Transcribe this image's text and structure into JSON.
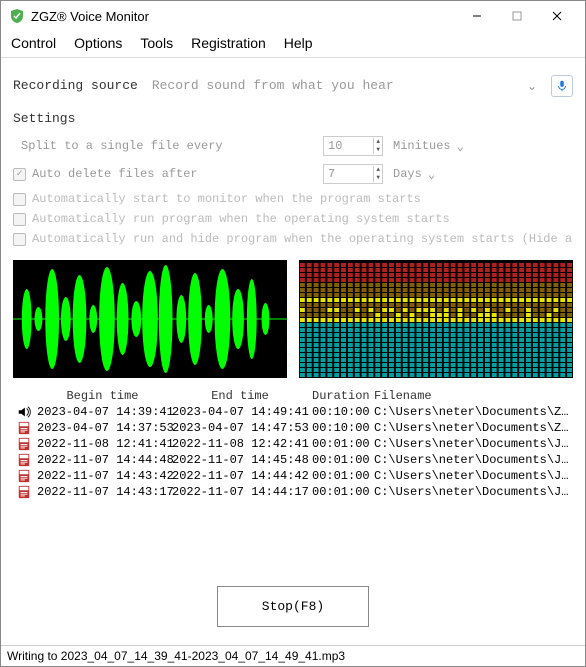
{
  "window": {
    "title": "ZGZ® Voice Monitor"
  },
  "menu": {
    "items": [
      {
        "label": "Control"
      },
      {
        "label": "Options"
      },
      {
        "label": "Tools"
      },
      {
        "label": "Registration"
      },
      {
        "label": "Help"
      }
    ]
  },
  "source": {
    "label": "Recording source",
    "value": "Record sound from what you hear"
  },
  "settings": {
    "header": "Settings",
    "split": {
      "label": "Split to a single file every",
      "value": "10",
      "unit": "Minitues"
    },
    "autodelete": {
      "label": "Auto delete files after",
      "value": "7",
      "unit": "Days",
      "checked": true
    },
    "opts": [
      {
        "label": "Automatically start to monitor when the program starts",
        "checked": false
      },
      {
        "label": "Automatically run program when the operating system starts",
        "checked": false
      },
      {
        "label": "Automatically run and hide program when the operating system starts (Hide and show hotk",
        "checked": false
      }
    ]
  },
  "table": {
    "headers": {
      "begin": "Begin time",
      "end": "End time",
      "dur": "Duration",
      "file": "Filename"
    },
    "rows": [
      {
        "playing": true,
        "begin": "2023-04-07 14:39:41",
        "end": "2023-04-07 14:49:41",
        "dur": "00:10:00",
        "file": "C:\\Users\\neter\\Documents\\ZGZ ..."
      },
      {
        "playing": false,
        "begin": "2023-04-07 14:37:53",
        "end": "2023-04-07 14:47:53",
        "dur": "00:10:00",
        "file": "C:\\Users\\neter\\Documents\\ZGZ ..."
      },
      {
        "playing": false,
        "begin": "2022-11-08 12:41:41",
        "end": "2022-11-08 12:42:41",
        "dur": "00:01:00",
        "file": "C:\\Users\\neter\\Documents\\JFY ..."
      },
      {
        "playing": false,
        "begin": "2022-11-07 14:44:48",
        "end": "2022-11-07 14:45:48",
        "dur": "00:01:00",
        "file": "C:\\Users\\neter\\Documents\\JFY ..."
      },
      {
        "playing": false,
        "begin": "2022-11-07 14:43:42",
        "end": "2022-11-07 14:44:42",
        "dur": "00:01:00",
        "file": "C:\\Users\\neter\\Documents\\JFY ..."
      },
      {
        "playing": false,
        "begin": "2022-11-07 14:43:17",
        "end": "2022-11-07 14:44:17",
        "dur": "00:01:00",
        "file": "C:\\Users\\neter\\Documents\\JFY ..."
      }
    ]
  },
  "stop": {
    "label": "Stop(F8)"
  },
  "status": {
    "text": "Writing to 2023_04_07_14_39_41-2023_04_07_14_49_41.mp3"
  }
}
